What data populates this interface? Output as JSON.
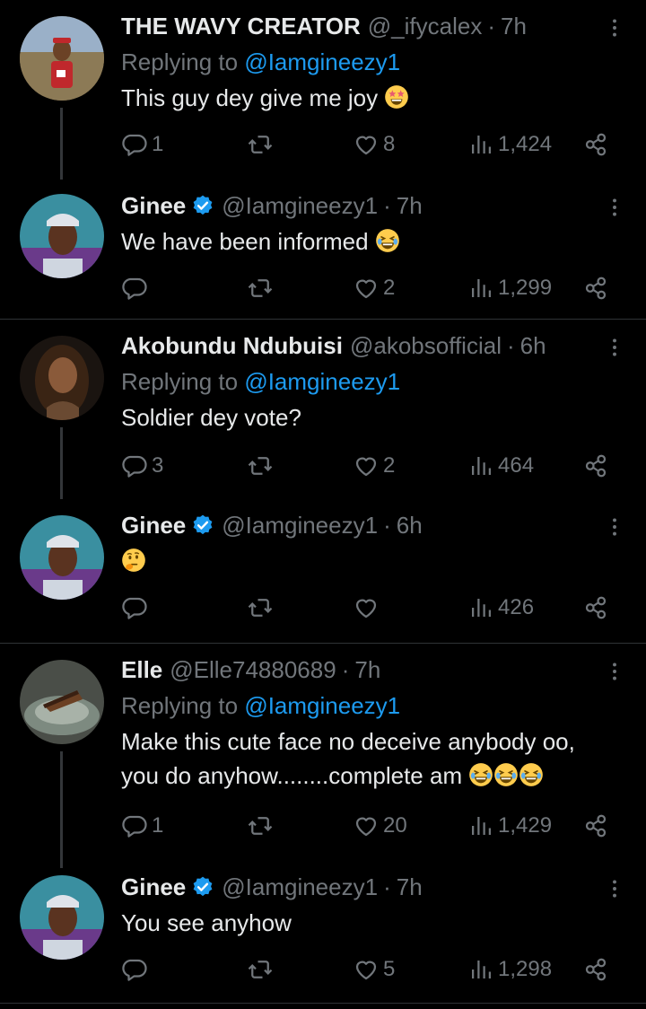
{
  "colors": {
    "background": "#000000",
    "text_primary": "#e7e9ea",
    "text_secondary": "#71767b",
    "accent": "#1d9bf0",
    "divider": "#2f3336"
  },
  "threads": [
    {
      "tweets": [
        {
          "name": "THE WAVY CREATOR",
          "handle": "@_ifycalex",
          "dot": "·",
          "time": "7h",
          "replying_prefix": "Replying to ",
          "replying_to": "@Iamgineezy1",
          "text": "This guy dey give me joy",
          "emoji": [
            "star-struck-face-icon"
          ],
          "replies": "1",
          "retweets": "",
          "likes": "8",
          "views": "1,424"
        },
        {
          "name": "Ginee",
          "verified": true,
          "handle": "@Iamgineezy1",
          "dot": "·",
          "time": "7h",
          "text": "We have been informed",
          "emoji": [
            "laughing-face-icon"
          ],
          "replies": "",
          "retweets": "",
          "likes": "2",
          "views": "1,299"
        }
      ]
    },
    {
      "tweets": [
        {
          "name": "Akobundu Ndubuisi",
          "handle": "@akobsofficial",
          "dot": "·",
          "time": "6h",
          "replying_prefix": "Replying to ",
          "replying_to": "@Iamgineezy1",
          "text": "Soldier dey vote?",
          "replies": "3",
          "retweets": "",
          "likes": "2",
          "views": "464"
        },
        {
          "name": "Ginee",
          "verified": true,
          "handle": "@Iamgineezy1",
          "dot": "·",
          "time": "6h",
          "text": "",
          "emoji": [
            "thinking-face-icon"
          ],
          "replies": "",
          "retweets": "",
          "likes": "",
          "views": "426"
        }
      ]
    },
    {
      "tweets": [
        {
          "name": "Elle",
          "handle": "@Elle74880689",
          "dot": "·",
          "time": "7h",
          "replying_prefix": "Replying to ",
          "replying_to": "@Iamgineezy1",
          "text_line1": "Make this cute face no deceive anybody oo,",
          "text_line2": "you do anyhow........complete am",
          "emoji": [
            "laughing-face-icon",
            "laughing-face-icon",
            "laughing-face-icon"
          ],
          "replies": "1",
          "retweets": "",
          "likes": "20",
          "views": "1,429"
        },
        {
          "name": "Ginee",
          "verified": true,
          "handle": "@Iamgineezy1",
          "dot": "·",
          "time": "7h",
          "text": "You see anyhow",
          "replies": "",
          "retweets": "",
          "likes": "5",
          "views": "1,298"
        }
      ]
    }
  ]
}
